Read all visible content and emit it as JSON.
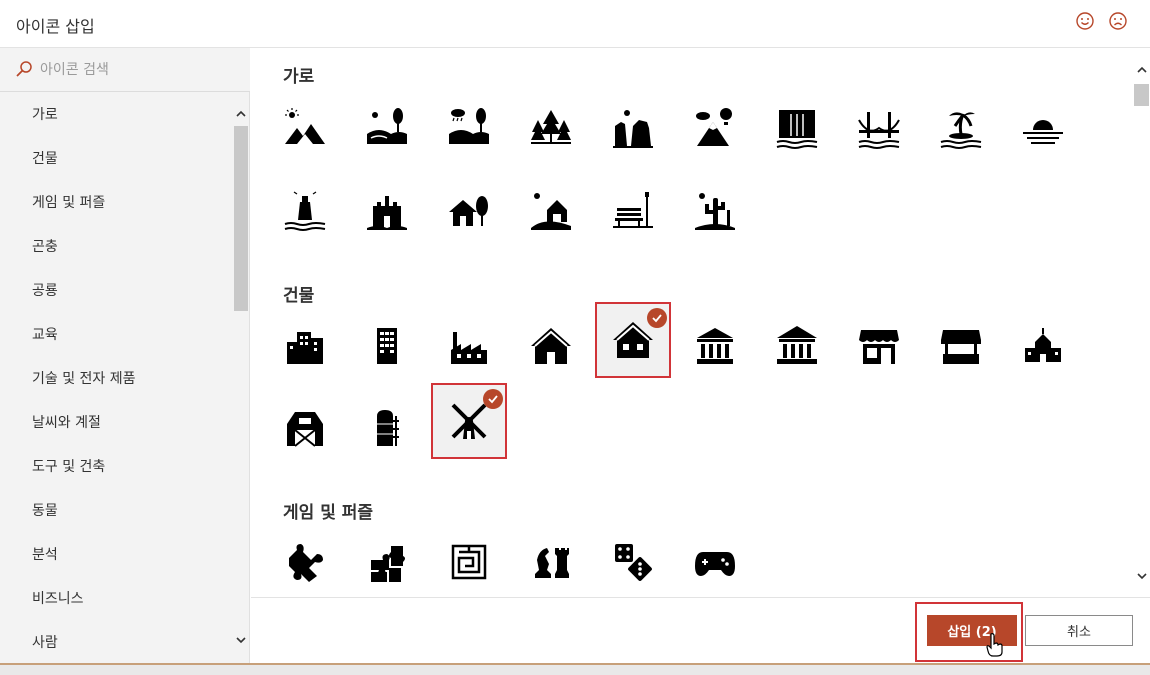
{
  "dialog": {
    "title": "아이콘 삽입"
  },
  "search": {
    "placeholder": "아이콘 검색"
  },
  "categories": [
    {
      "label": "가로"
    },
    {
      "label": "건물"
    },
    {
      "label": "게임 및 퍼즐"
    },
    {
      "label": "곤충"
    },
    {
      "label": "공룡"
    },
    {
      "label": "교육"
    },
    {
      "label": "기술 및 전자 제품"
    },
    {
      "label": "날씨와 계절"
    },
    {
      "label": "도구 및 건축"
    },
    {
      "label": "동물"
    },
    {
      "label": "분석"
    },
    {
      "label": "비즈니스"
    },
    {
      "label": "사람"
    }
  ],
  "sections": [
    {
      "title": "가로",
      "icons": [
        "mountains-sun",
        "hills-trees-sun",
        "hills-trees-rain",
        "pine-forest",
        "canyon-sun",
        "mountain-balloon",
        "waterfall",
        "bridge",
        "palm-island",
        "sunset-water",
        "lighthouse",
        "castle",
        "house-tree",
        "barn-sun",
        "park-bench",
        "desert-cactus"
      ]
    },
    {
      "title": "건물",
      "icons": [
        "city-buildings",
        "office-tower",
        "factory",
        "house",
        "house-windows",
        "bank",
        "museum",
        "store-awning",
        "market-stall",
        "school",
        "barn",
        "silo",
        "windmill"
      ]
    },
    {
      "title": "게임 및 퍼즐",
      "icons": [
        "puzzle-piece",
        "puzzle-pieces",
        "maze",
        "chess-pieces",
        "dice",
        "gamepad"
      ]
    }
  ],
  "selection": {
    "selected_icons": [
      "house-windows",
      "windmill"
    ]
  },
  "footer": {
    "insert_label": "삽입 (2)",
    "cancel_label": "취소"
  },
  "colors": {
    "accent": "#b7472a",
    "highlight": "#d13438",
    "sidebar_bg": "#f3f3f3"
  }
}
